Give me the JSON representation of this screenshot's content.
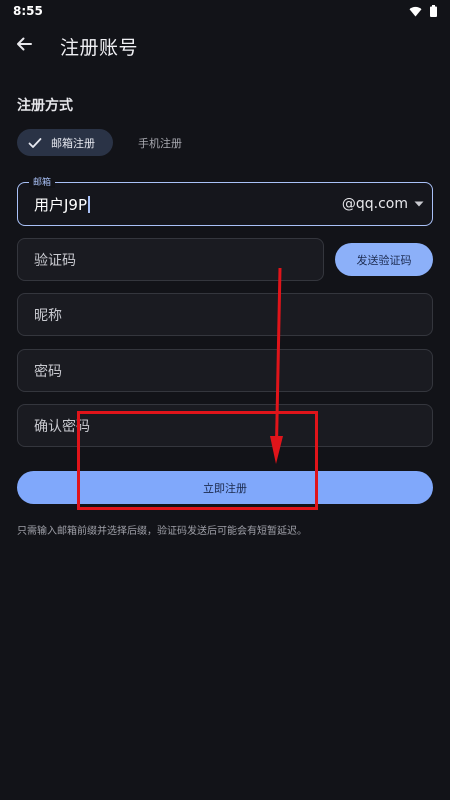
{
  "status_bar": {
    "time": "8:55"
  },
  "app_bar": {
    "title": "注册账号"
  },
  "section": {
    "title": "注册方式"
  },
  "method_chips": {
    "email": "邮箱注册",
    "phone": "手机注册"
  },
  "form": {
    "email": {
      "label": "邮箱",
      "value": "用户J9P",
      "domain": "@qq.com"
    },
    "code": {
      "placeholder": "验证码",
      "send_button": "发送验证码"
    },
    "nickname": {
      "placeholder": "昵称"
    },
    "password": {
      "placeholder": "密码"
    },
    "confirm_password": {
      "placeholder": "确认密码"
    },
    "submit_button": "立即注册",
    "hint": "只需输入邮箱前缀并选择后缀，验证码发送后可能会有短暂延迟。"
  },
  "colors": {
    "background": "#121318",
    "accent": "#80a8fb",
    "focus_outline": "#a9c1f7",
    "annotation": "#e0141a"
  },
  "icons": [
    "wifi-icon",
    "battery-icon",
    "back-arrow-icon",
    "check-icon",
    "dropdown-arrow-icon"
  ]
}
